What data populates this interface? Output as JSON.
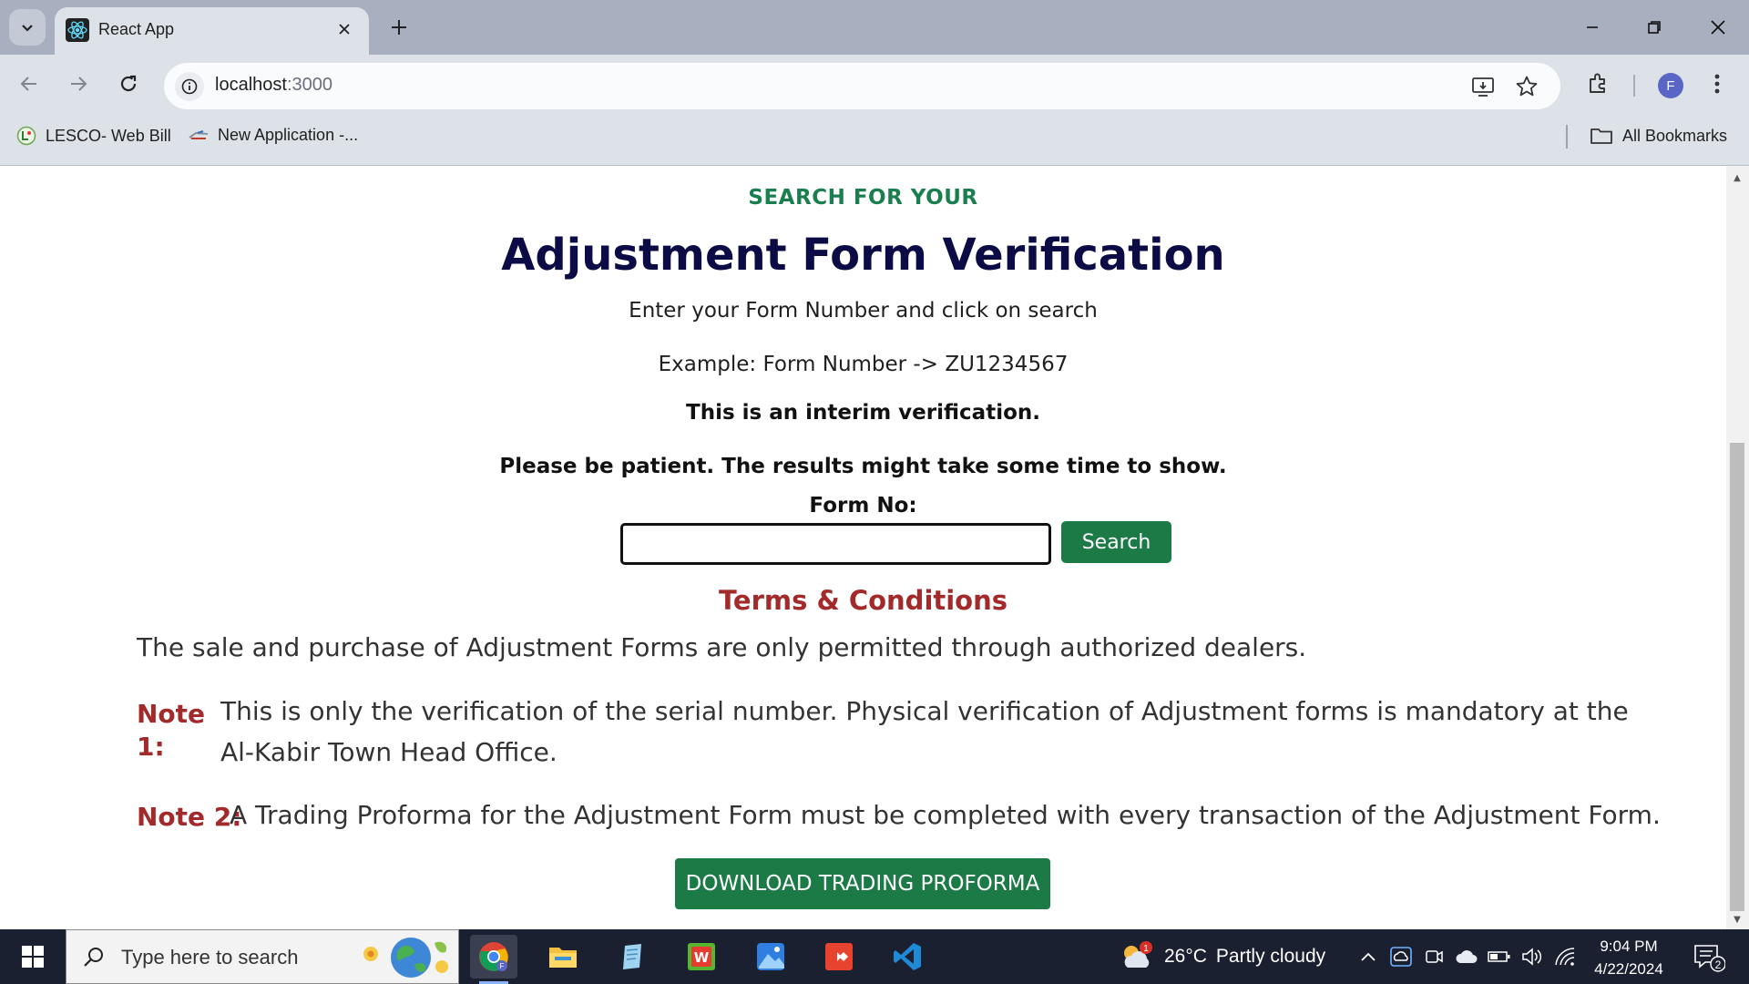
{
  "browser": {
    "tab_title": "React App",
    "url_host": "localhost",
    "url_port": ":3000",
    "profile_initial": "F",
    "bookmarks": [
      {
        "label": "LESCO- Web Bill"
      },
      {
        "label": "New Application -..."
      }
    ],
    "all_bookmarks_label": "All Bookmarks"
  },
  "page": {
    "kicker": "SEARCH FOR YOUR",
    "title": "Adjustment Form Verification",
    "instruction": "Enter your Form Number and click on search",
    "example": "Example: Form Number -> ZU1234567",
    "interim_notice": "This is an interim verification.",
    "patience_notice": "Please be patient. The results might take some time to show.",
    "form_label": "Form No:",
    "form_value": "",
    "form_placeholder": "",
    "search_button": "Search",
    "terms_title": "Terms & Conditions",
    "terms_text": "The sale and purchase of Adjustment Forms are only permitted through authorized dealers.",
    "note1_label": "Note 1:",
    "note1_text": "This is only the verification of the serial number. Physical verification of Adjustment forms is mandatory at the Al-Kabir Town Head Office.",
    "note2_label": "Note 2:",
    "note2_text": "A Trading Proforma for the Adjustment Form must be completed with every transaction of the Adjustment Form.",
    "download_button": "DOWNLOAD TRADING PROFORMA"
  },
  "taskbar": {
    "search_placeholder": "Type here to search",
    "weather_temp": "26°C",
    "weather_desc": "Partly cloudy",
    "weather_badge": "1",
    "time": "9:04 PM",
    "date": "4/22/2024",
    "notification_count": "2"
  },
  "colors": {
    "accent_green": "#1c7a47",
    "kicker_green": "#1a7f4e",
    "title_navy": "#0b0b45",
    "terms_red": "#a22a2a"
  },
  "icons": [
    "tab-list-icon",
    "react-logo-icon",
    "close-icon",
    "plus-icon",
    "minimize-icon",
    "restore-icon",
    "back-icon",
    "forward-icon",
    "reload-icon",
    "site-info-icon",
    "install-app-icon",
    "bookmark-star-icon",
    "extensions-icon",
    "more-menu-icon",
    "folder-icon",
    "windows-logo-icon",
    "search-icon",
    "chrome-icon",
    "file-explorer-icon",
    "notepad-icon",
    "wps-icon",
    "photos-icon",
    "git-icon",
    "vscode-icon",
    "weather-icon",
    "chevron-up-icon",
    "onedrive-icon",
    "meet-icon",
    "cloud-icon",
    "battery-icon",
    "volume-icon",
    "wifi-icon",
    "notification-icon"
  ]
}
